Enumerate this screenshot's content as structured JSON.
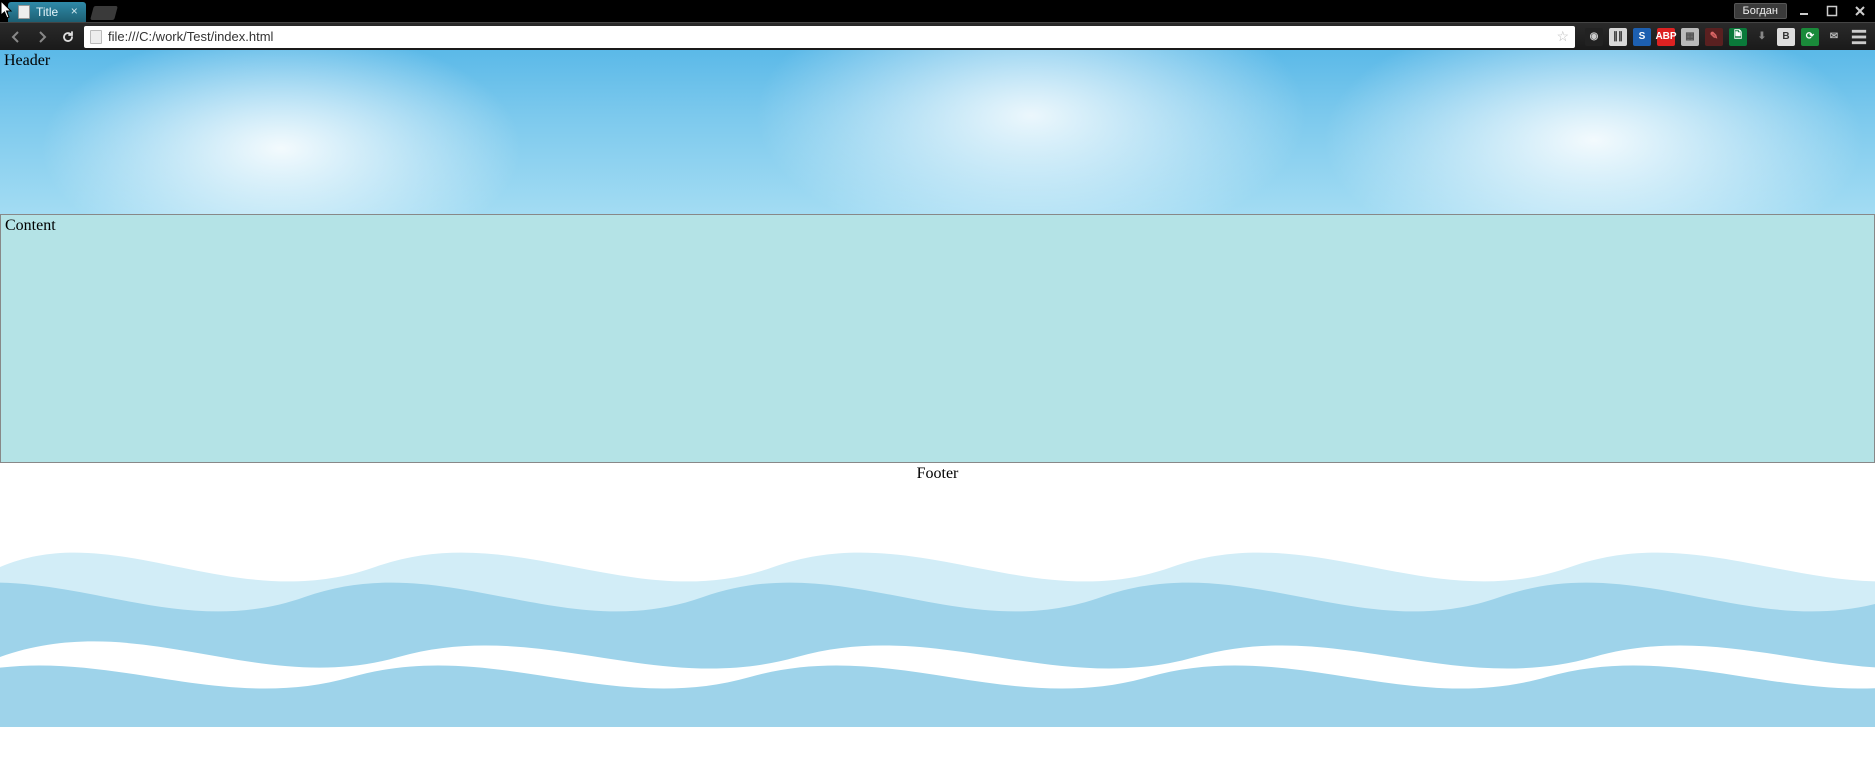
{
  "titlebar": {
    "tab_title": "Title",
    "user": "Богдан"
  },
  "toolbar": {
    "url": "file:///C:/work/Test/index.html"
  },
  "extensions": [
    {
      "name": "ext-power",
      "bg": "#222",
      "fg": "#ccc",
      "glyph": "◉"
    },
    {
      "name": "ext-barcode",
      "bg": "#d8d8d8",
      "fg": "#333",
      "glyph": "∥∥"
    },
    {
      "name": "ext-s",
      "bg": "#1d5fb0",
      "fg": "#fff",
      "glyph": "S"
    },
    {
      "name": "ext-abp",
      "bg": "#d22",
      "fg": "#fff",
      "glyph": "ABP"
    },
    {
      "name": "ext-pixel",
      "bg": "#bbb",
      "fg": "#555",
      "glyph": "▦"
    },
    {
      "name": "ext-brush",
      "bg": "#5a2020",
      "fg": "#d66",
      "glyph": "✎"
    },
    {
      "name": "ext-doc",
      "bg": "#0a7a3a",
      "fg": "#fff",
      "glyph": "🗎"
    },
    {
      "name": "ext-download",
      "bg": "transparent",
      "fg": "#888",
      "glyph": "⬇"
    },
    {
      "name": "ext-b",
      "bg": "#ddd",
      "fg": "#333",
      "glyph": "B"
    },
    {
      "name": "ext-new",
      "bg": "#1a8a3a",
      "fg": "#fff",
      "glyph": "⟳"
    },
    {
      "name": "ext-mail",
      "bg": "transparent",
      "fg": "#bbb",
      "glyph": "✉"
    }
  ],
  "page": {
    "header_text": "Header",
    "content_text": "Content",
    "footer_text": "Footer"
  },
  "colors": {
    "content_bg": "#b4e3e6",
    "sky1": "#5bb9e8",
    "wave_light": "#d2edf7",
    "wave_mid": "#9ed3ea"
  }
}
